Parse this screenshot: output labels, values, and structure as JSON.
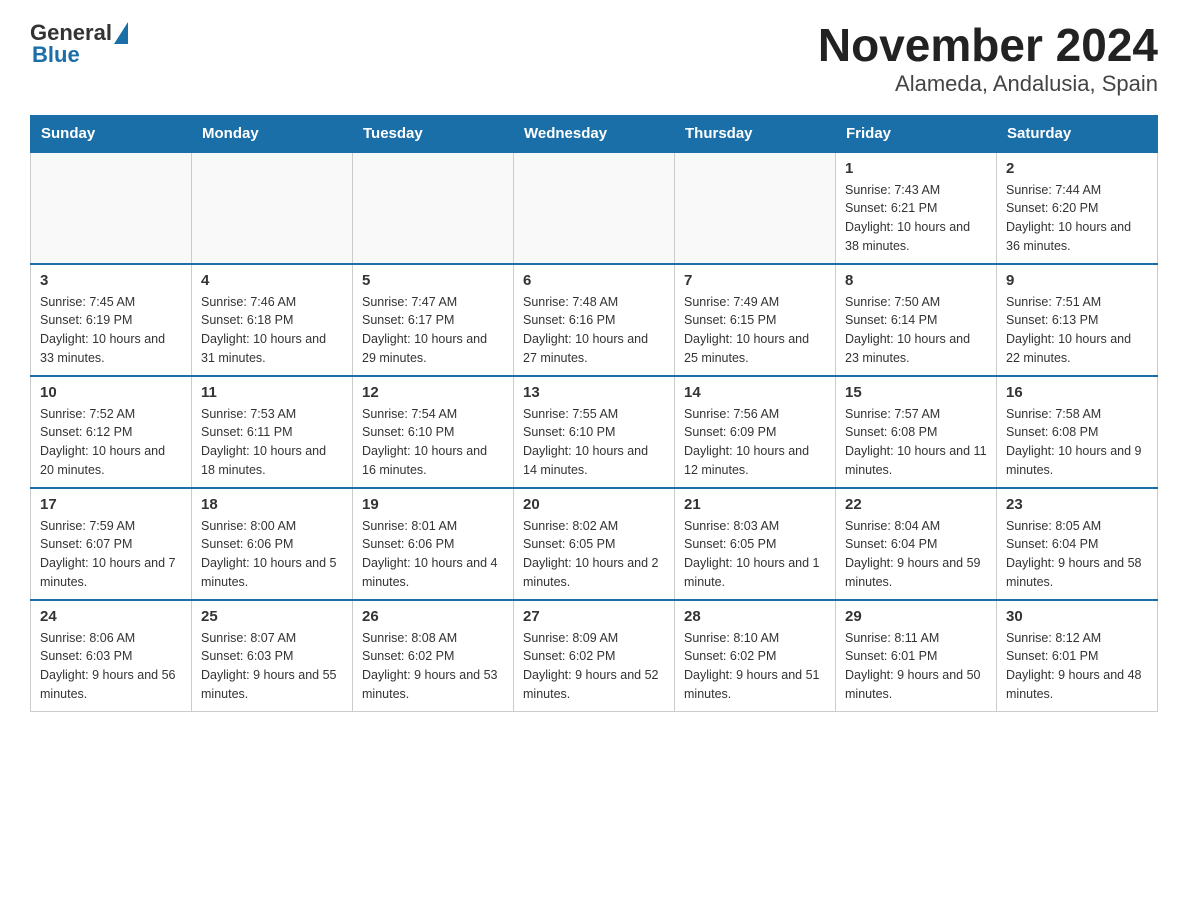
{
  "logo": {
    "general": "General",
    "blue": "Blue"
  },
  "title": "November 2024",
  "subtitle": "Alameda, Andalusia, Spain",
  "days_of_week": [
    "Sunday",
    "Monday",
    "Tuesday",
    "Wednesday",
    "Thursday",
    "Friday",
    "Saturday"
  ],
  "weeks": [
    [
      {
        "day": "",
        "info": ""
      },
      {
        "day": "",
        "info": ""
      },
      {
        "day": "",
        "info": ""
      },
      {
        "day": "",
        "info": ""
      },
      {
        "day": "",
        "info": ""
      },
      {
        "day": "1",
        "info": "Sunrise: 7:43 AM\nSunset: 6:21 PM\nDaylight: 10 hours and 38 minutes."
      },
      {
        "day": "2",
        "info": "Sunrise: 7:44 AM\nSunset: 6:20 PM\nDaylight: 10 hours and 36 minutes."
      }
    ],
    [
      {
        "day": "3",
        "info": "Sunrise: 7:45 AM\nSunset: 6:19 PM\nDaylight: 10 hours and 33 minutes."
      },
      {
        "day": "4",
        "info": "Sunrise: 7:46 AM\nSunset: 6:18 PM\nDaylight: 10 hours and 31 minutes."
      },
      {
        "day": "5",
        "info": "Sunrise: 7:47 AM\nSunset: 6:17 PM\nDaylight: 10 hours and 29 minutes."
      },
      {
        "day": "6",
        "info": "Sunrise: 7:48 AM\nSunset: 6:16 PM\nDaylight: 10 hours and 27 minutes."
      },
      {
        "day": "7",
        "info": "Sunrise: 7:49 AM\nSunset: 6:15 PM\nDaylight: 10 hours and 25 minutes."
      },
      {
        "day": "8",
        "info": "Sunrise: 7:50 AM\nSunset: 6:14 PM\nDaylight: 10 hours and 23 minutes."
      },
      {
        "day": "9",
        "info": "Sunrise: 7:51 AM\nSunset: 6:13 PM\nDaylight: 10 hours and 22 minutes."
      }
    ],
    [
      {
        "day": "10",
        "info": "Sunrise: 7:52 AM\nSunset: 6:12 PM\nDaylight: 10 hours and 20 minutes."
      },
      {
        "day": "11",
        "info": "Sunrise: 7:53 AM\nSunset: 6:11 PM\nDaylight: 10 hours and 18 minutes."
      },
      {
        "day": "12",
        "info": "Sunrise: 7:54 AM\nSunset: 6:10 PM\nDaylight: 10 hours and 16 minutes."
      },
      {
        "day": "13",
        "info": "Sunrise: 7:55 AM\nSunset: 6:10 PM\nDaylight: 10 hours and 14 minutes."
      },
      {
        "day": "14",
        "info": "Sunrise: 7:56 AM\nSunset: 6:09 PM\nDaylight: 10 hours and 12 minutes."
      },
      {
        "day": "15",
        "info": "Sunrise: 7:57 AM\nSunset: 6:08 PM\nDaylight: 10 hours and 11 minutes."
      },
      {
        "day": "16",
        "info": "Sunrise: 7:58 AM\nSunset: 6:08 PM\nDaylight: 10 hours and 9 minutes."
      }
    ],
    [
      {
        "day": "17",
        "info": "Sunrise: 7:59 AM\nSunset: 6:07 PM\nDaylight: 10 hours and 7 minutes."
      },
      {
        "day": "18",
        "info": "Sunrise: 8:00 AM\nSunset: 6:06 PM\nDaylight: 10 hours and 5 minutes."
      },
      {
        "day": "19",
        "info": "Sunrise: 8:01 AM\nSunset: 6:06 PM\nDaylight: 10 hours and 4 minutes."
      },
      {
        "day": "20",
        "info": "Sunrise: 8:02 AM\nSunset: 6:05 PM\nDaylight: 10 hours and 2 minutes."
      },
      {
        "day": "21",
        "info": "Sunrise: 8:03 AM\nSunset: 6:05 PM\nDaylight: 10 hours and 1 minute."
      },
      {
        "day": "22",
        "info": "Sunrise: 8:04 AM\nSunset: 6:04 PM\nDaylight: 9 hours and 59 minutes."
      },
      {
        "day": "23",
        "info": "Sunrise: 8:05 AM\nSunset: 6:04 PM\nDaylight: 9 hours and 58 minutes."
      }
    ],
    [
      {
        "day": "24",
        "info": "Sunrise: 8:06 AM\nSunset: 6:03 PM\nDaylight: 9 hours and 56 minutes."
      },
      {
        "day": "25",
        "info": "Sunrise: 8:07 AM\nSunset: 6:03 PM\nDaylight: 9 hours and 55 minutes."
      },
      {
        "day": "26",
        "info": "Sunrise: 8:08 AM\nSunset: 6:02 PM\nDaylight: 9 hours and 53 minutes."
      },
      {
        "day": "27",
        "info": "Sunrise: 8:09 AM\nSunset: 6:02 PM\nDaylight: 9 hours and 52 minutes."
      },
      {
        "day": "28",
        "info": "Sunrise: 8:10 AM\nSunset: 6:02 PM\nDaylight: 9 hours and 51 minutes."
      },
      {
        "day": "29",
        "info": "Sunrise: 8:11 AM\nSunset: 6:01 PM\nDaylight: 9 hours and 50 minutes."
      },
      {
        "day": "30",
        "info": "Sunrise: 8:12 AM\nSunset: 6:01 PM\nDaylight: 9 hours and 48 minutes."
      }
    ]
  ]
}
